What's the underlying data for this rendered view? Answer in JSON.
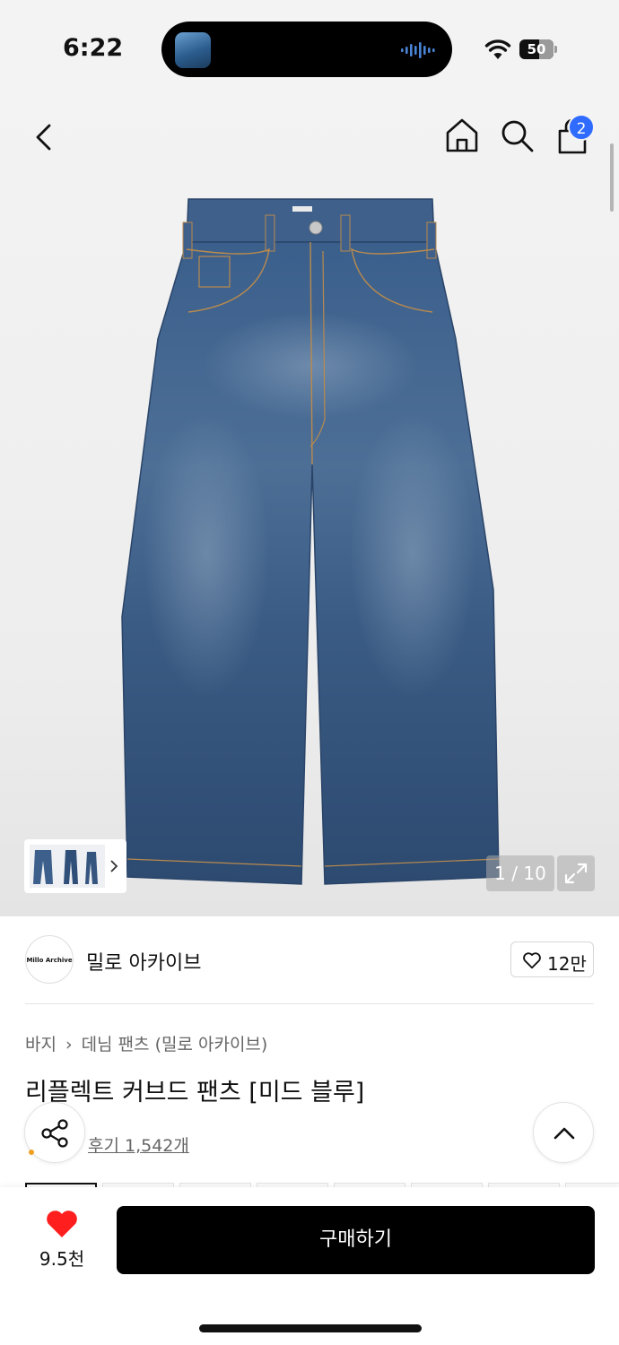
{
  "status_bar": {
    "time": "6:22",
    "battery": "50"
  },
  "header": {
    "cart_count": "2"
  },
  "gallery": {
    "counter": "1 / 10"
  },
  "brand": {
    "logo_text": "Millo Archive",
    "name": "밀로 아카이브",
    "likes": "12만"
  },
  "breadcrumb": {
    "category": "바지",
    "subcategory": "데님 팬츠 (밀로 아카이브)"
  },
  "product": {
    "title": "리플렉트 커브드 팬츠 [미드 블루]",
    "reviews": "후기 1,542개"
  },
  "bottom_bar": {
    "wish_count": "9.5천",
    "buy_label": "구매하기"
  },
  "colors": {
    "accent_badge": "#2f6bff",
    "heart": "#ff1e1e",
    "buy_button": "#000000"
  },
  "icons": [
    "back-icon",
    "home-icon",
    "search-icon",
    "shopping-bag-icon",
    "expand-icon",
    "heart-outline-icon",
    "share-icon",
    "chevron-up-icon",
    "heart-icon",
    "wifi-icon",
    "chevron-right-icon"
  ]
}
